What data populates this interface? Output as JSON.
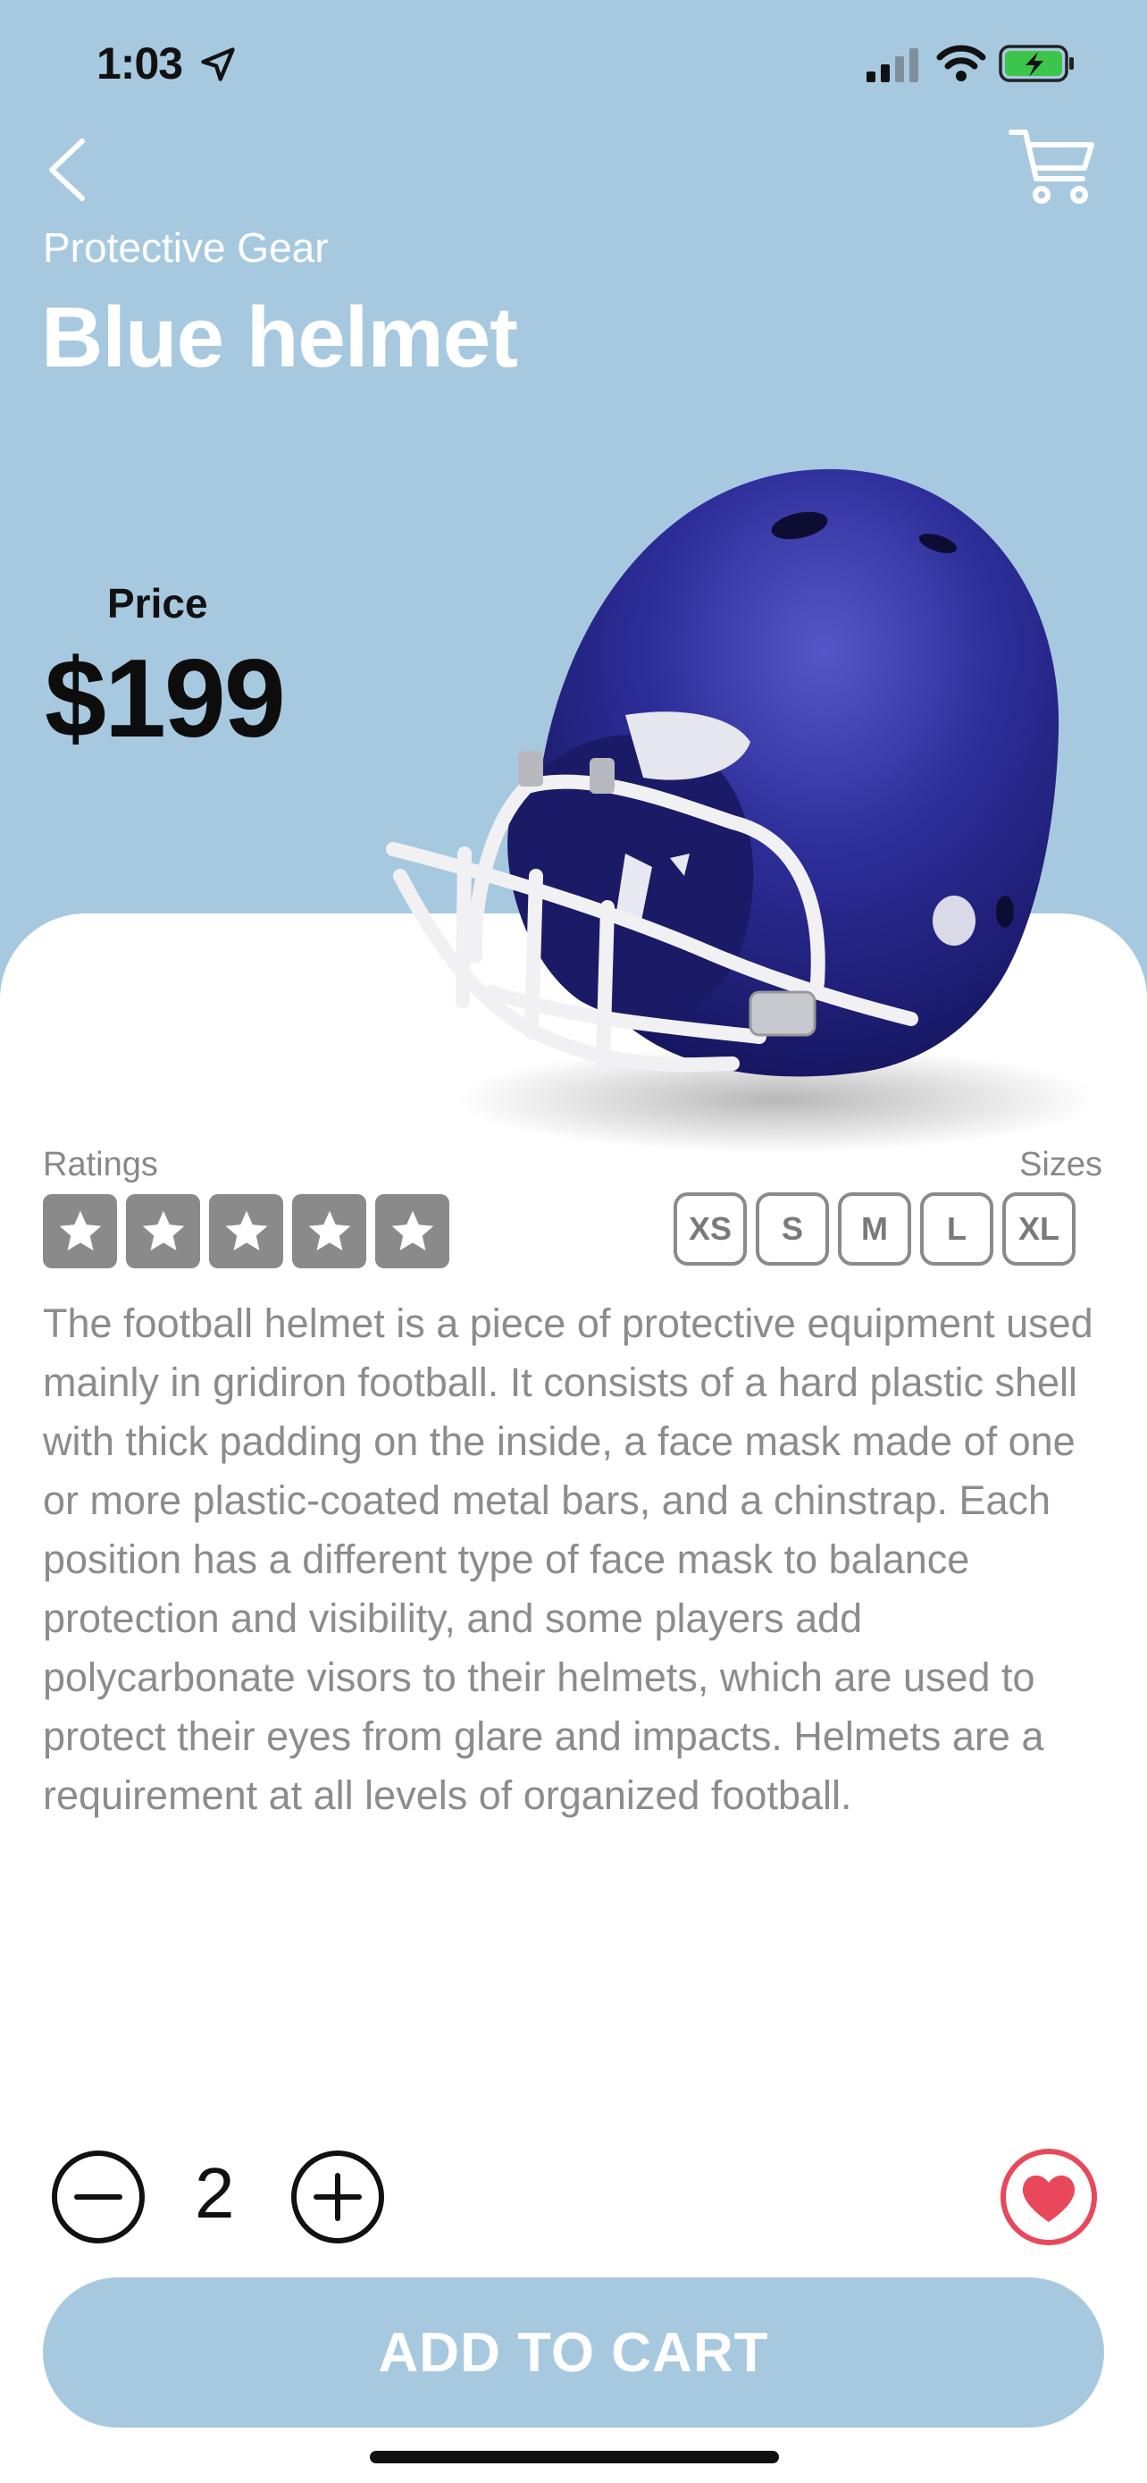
{
  "status_bar": {
    "time": "1:03",
    "icons": [
      "location-arrow-icon",
      "cellular-signal-icon",
      "wifi-icon",
      "battery-charging-icon"
    ]
  },
  "header": {
    "back_icon": "chevron-left-icon",
    "cart_icon": "shopping-cart-icon",
    "category": "Protective Gear",
    "title": "Blue helmet"
  },
  "price": {
    "label": "Price",
    "value": "$199"
  },
  "product_image": "football-helmet-image",
  "ratings": {
    "label": "Ratings",
    "stars": 5,
    "max": 5
  },
  "sizes": {
    "label": "Sizes",
    "options": [
      "XS",
      "S",
      "M",
      "L",
      "XL"
    ]
  },
  "description": "The football helmet is a piece of protective equipment used mainly in gridiron football. It consists of a hard plastic shell with thick padding on the inside, a face mask made of one or more plastic-coated metal bars, and a chinstrap. Each position has a different type of face mask to balance protection and visibility, and some players add polycarbonate visors to their helmets, which are used to protect their eyes from glare and impacts. Helmets are a requirement at all levels of organized football.",
  "quantity": {
    "value": "2",
    "minus_icon": "minus-circle-icon",
    "plus_icon": "plus-circle-icon"
  },
  "favorite_icon": "heart-icon",
  "add_to_cart_label": "ADD TO CART",
  "colors": {
    "background": "#a7c9e0",
    "accent_red": "#e8485a",
    "helmet_blue": "#2a2a8c",
    "muted_text": "#8c8c8c"
  }
}
